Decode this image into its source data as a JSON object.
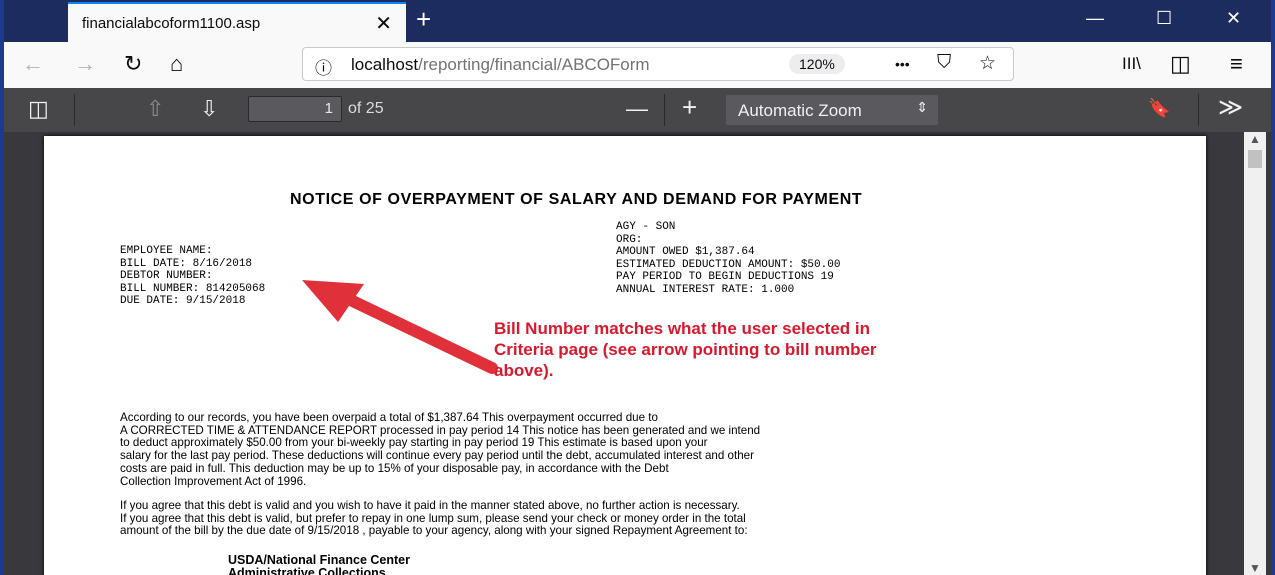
{
  "browser": {
    "tab_title": "financialabcoform1100.asp",
    "tab_close": "✕",
    "new_tab": "+",
    "window": {
      "minimize": "—",
      "maximize": "☐",
      "close": "✕"
    },
    "nav": {
      "back": "←",
      "forward": "→",
      "reload": "↻",
      "home": "⌂"
    },
    "url_info": "ⓘ",
    "url_host": "localhost",
    "url_path": "/reporting/financial/ABCOForm",
    "zoom_badge": "120%",
    "url_more": "•••",
    "url_pocket": "⛉",
    "url_star": "☆",
    "library": "III\\",
    "sidebar": "◫",
    "menu": "≡"
  },
  "pdf_toolbar": {
    "sidebar_toggle": "◫",
    "prev_page": "⇧",
    "next_page": "⇩",
    "page_number": "1",
    "page_of": "of 25",
    "zoom_out": "—",
    "zoom_in": "+",
    "zoom_select": "Automatic Zoom",
    "zoom_arrow": "⇕",
    "bookmark": "🔖",
    "tools": "≫"
  },
  "document": {
    "title": "NOTICE OF OVERPAYMENT OF SALARY AND DEMAND FOR PAYMENT",
    "left_fields": [
      "EMPLOYEE NAME:",
      "BILL DATE: 8/16/2018",
      "DEBTOR NUMBER:",
      "BILL NUMBER: 814205068",
      "DUE DATE: 9/15/2018"
    ],
    "right_fields": [
      "AGY - SON",
      "ORG:",
      "AMOUNT OWED $1,387.64",
      "ESTIMATED DEDUCTION AMOUNT: $50.00",
      "PAY PERIOD TO BEGIN DEDUCTIONS 19",
      "ANNUAL INTEREST RATE: 1.000"
    ],
    "callout": [
      "Bill Number matches what the user selected in",
      "Criteria page (see arrow pointing to bill number",
      "above)."
    ],
    "paragraph1": [
      "According to our records, you have been overpaid a total of  $1,387.64            This overpayment occurred due to",
      " A CORRECTED TIME & ATTENDANCE REPORT      processed in pay period 14      This notice has been generated and we intend",
      "to deduct approximately $50.00        from your bi-weekly pay starting in pay period 19       This estimate is based upon your",
      "salary for the last pay period.  These deductions will continue every pay period until the debt, accumulated interest and other",
      "costs are paid in full.  This deduction may be up to 15% of your disposable pay, in accordance with the Debt",
      "Collection Improvement Act of 1996."
    ],
    "paragraph2": [
      "If you agree that this debt is valid and you wish to have it paid in the manner stated above, no further action is necessary.",
      "If you agree that this debt is valid, but prefer to repay in one lump sum, please send your check or money order in the total",
      "amount of the bill by the due date of 9/15/2018   , payable to your agency, along with your signed Repayment Agreement to:"
    ],
    "address": [
      "USDA/National Finance Center",
      "Administrative Collections"
    ]
  }
}
